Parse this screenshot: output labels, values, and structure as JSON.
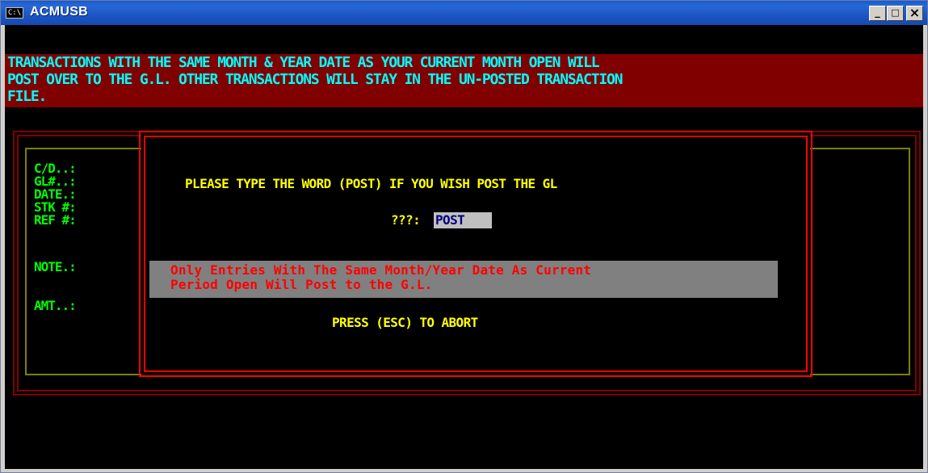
{
  "window": {
    "title": "ACMUSB",
    "icon_text": "C:\\",
    "icon": "console-icon",
    "minimize_label": "_",
    "maximize_label": "□",
    "close_label": "×"
  },
  "banner": {
    "lines": [
      "TRANSACTIONS WITH THE SAME MONTH & YEAR DATE AS YOUR CURRENT MONTH OPEN WILL",
      "POST OVER TO THE G.L. OTHER TRANSACTIONS WILL STAY IN THE UN-POSTED TRANSACTION",
      "FILE."
    ]
  },
  "form": {
    "labels": [
      "C/D..:",
      "GL#..:",
      "DATE.:",
      "STK #:",
      "REF #:",
      "NOTE.:",
      "AMT..:"
    ]
  },
  "dialog": {
    "prompt": "PLEASE TYPE THE WORD (POST) IF YOU WISH POST THE GL",
    "input_label": "???:",
    "input_value": "POST",
    "note_lines": [
      "Only Entries With The Same Month/Year Date As Current",
      "Period Open Will Post to the G.L."
    ],
    "abort_text": "PRESS (ESC) TO ABORT"
  },
  "colors": {
    "banner_bg": "#800000",
    "banner_text": "#00ffff",
    "label_text": "#00ff00",
    "prompt_text": "#ffff00",
    "note_text": "#ff0000",
    "note_bg": "#808080",
    "frame_red": "#ff0000",
    "frame_dark_red": "#800000",
    "frame_olive": "#808000"
  }
}
